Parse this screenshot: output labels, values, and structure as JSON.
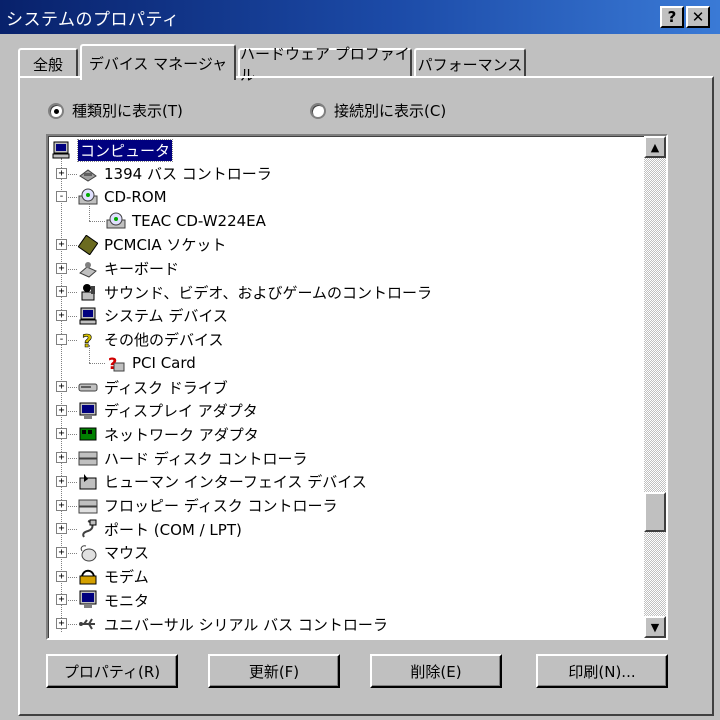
{
  "window": {
    "title": "システムのプロパティ",
    "help_label": "?",
    "close_label": "✕"
  },
  "tabs": [
    {
      "label": "全般"
    },
    {
      "label": "デバイス マネージャ",
      "active": true
    },
    {
      "label": "ハードウェア プロファイル"
    },
    {
      "label": "パフォーマンス"
    }
  ],
  "view_options": {
    "by_type": "種類別に表示(T)",
    "by_connection": "接続別に表示(C)",
    "selected": "by_type"
  },
  "tree": [
    {
      "label": "コンピュータ",
      "icon": "computer-icon",
      "level": 0,
      "selected": true
    },
    {
      "label": "1394 バス コントローラ",
      "icon": "bus-controller-icon",
      "level": 1,
      "expander": "+"
    },
    {
      "label": "CD-ROM",
      "icon": "cdrom-icon",
      "level": 1,
      "expander": "-"
    },
    {
      "label": "TEAC CD-W224EA",
      "icon": "cdrom-icon",
      "level": 2
    },
    {
      "label": "PCMCIA ソケット",
      "icon": "pcmcia-icon",
      "level": 1,
      "expander": "+"
    },
    {
      "label": "キーボード",
      "icon": "keyboard-icon",
      "level": 1,
      "expander": "+"
    },
    {
      "label": "サウンド、ビデオ、およびゲームのコントローラ",
      "icon": "sound-icon",
      "level": 1,
      "expander": "+"
    },
    {
      "label": "システム デバイス",
      "icon": "system-device-icon",
      "level": 1,
      "expander": "+"
    },
    {
      "label": "その他のデバイス",
      "icon": "question-icon",
      "level": 1,
      "expander": "-"
    },
    {
      "label": "PCI Card",
      "icon": "unknown-device-icon",
      "level": 2
    },
    {
      "label": "ディスク ドライブ",
      "icon": "disk-drive-icon",
      "level": 1,
      "expander": "+"
    },
    {
      "label": "ディスプレイ アダプタ",
      "icon": "display-adapter-icon",
      "level": 1,
      "expander": "+"
    },
    {
      "label": "ネットワーク アダプタ",
      "icon": "network-adapter-icon",
      "level": 1,
      "expander": "+"
    },
    {
      "label": "ハード ディスク コントローラ",
      "icon": "hdd-controller-icon",
      "level": 1,
      "expander": "+"
    },
    {
      "label": "ヒューマン インターフェイス デバイス",
      "icon": "hid-icon",
      "level": 1,
      "expander": "+"
    },
    {
      "label": "フロッピー ディスク コントローラ",
      "icon": "floppy-controller-icon",
      "level": 1,
      "expander": "+"
    },
    {
      "label": "ポート (COM / LPT)",
      "icon": "port-icon",
      "level": 1,
      "expander": "+"
    },
    {
      "label": "マウス",
      "icon": "mouse-icon",
      "level": 1,
      "expander": "+"
    },
    {
      "label": "モデム",
      "icon": "modem-icon",
      "level": 1,
      "expander": "+"
    },
    {
      "label": "モニタ",
      "icon": "monitor-icon",
      "level": 1,
      "expander": "+"
    },
    {
      "label": "ユニバーサル シリアル バス コントローラ",
      "icon": "usb-icon",
      "level": 1,
      "expander": "+"
    }
  ],
  "scrollbar": {
    "up": "▲",
    "down": "▼",
    "position": 0.8
  },
  "buttons": {
    "properties": "プロパティ(R)",
    "refresh": "更新(F)",
    "remove": "削除(E)",
    "print": "印刷(N)..."
  }
}
